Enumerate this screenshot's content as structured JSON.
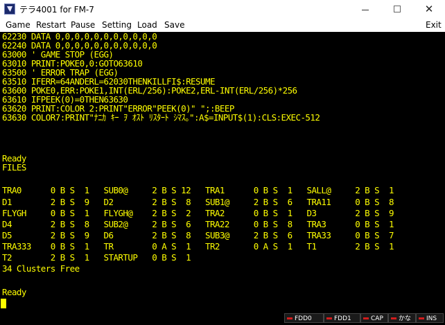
{
  "window": {
    "title": "テラ4001 for FM-7",
    "minimize_symbol": "",
    "maximize_symbol": "",
    "close_symbol": "✕"
  },
  "menu": {
    "items": [
      {
        "label": "Game"
      },
      {
        "label": "Restart"
      },
      {
        "label": "Pause"
      },
      {
        "label": "Setting"
      },
      {
        "label": "Load"
      },
      {
        "label": "Save"
      }
    ],
    "exit_label": "Exit"
  },
  "screen": {
    "text_color": "#ffff00",
    "background": "#000000",
    "lines": [
      "62230 DATA 0,0,0,0,0,0,0,0,0,0,0",
      "62240 DATA 0,0,0,0,0,0,0,0,0,0,0",
      "63000 ' GAME STOP (EGG)",
      "63010 PRINT:POKE0,0:GOTO63610",
      "63500 ' ERROR TRAP (EGG)",
      "63510 IFERR=64ANDERL=62030THENKILLFI$:RESUME",
      "63600 POKE0,ERR:POKE1,INT(ERL/256):POKE2,ERL-INT(ERL/256)*256",
      "63610 IFPEEK(0)=0THEN63630",
      "63620 PRINT:COLOR 2:PRINT\"ERROR\"PEEK(0)\" \";:BEEP",
      "63630 COLOR7:PRINT\"ﾅﾆｶ ｷｰ ｦ ｵｽﾄ ﾘｽﾀｰﾄ ｼﾏｽ｡\":A$=INPUT$(1):CLS:EXEC-512",
      "",
      "Ready",
      "FILES",
      "",
      "TRA0      0 B S  1   SUB0@     2 B S 12   TRA1      0 B S  1   SALL@     2 B S  1",
      "D1        2 B S  9   D2        2 B S  8   SUB1@     2 B S  6   TRA11     0 B S  8",
      "FLYGH     0 B S  1   FLYGH@    2 B S  2   TRA2      0 B S  1   D3        2 B S  9",
      "D4        2 B S  8   SUB2@     2 B S  6   TRA22     0 B S  8   TRA3      0 B S  1",
      "D5        2 B S  9   D6        2 B S  8   SUB3@     2 B S  6   TRA33     0 B S  7",
      "TRA333    0 B S  1   TR        0 A S  1   TR2       0 A S  1   T1        2 B S  1",
      "T2        2 B S  1   STARTUP   0 B S  1",
      "34 Clusters Free",
      "",
      "",
      "Ready"
    ]
  },
  "status": {
    "led_color": "#d21c1c",
    "indicators": [
      {
        "label": "FDD0"
      },
      {
        "label": "FDD1"
      },
      {
        "label": "CAP"
      },
      {
        "label": "かな"
      },
      {
        "label": "INS"
      }
    ]
  }
}
